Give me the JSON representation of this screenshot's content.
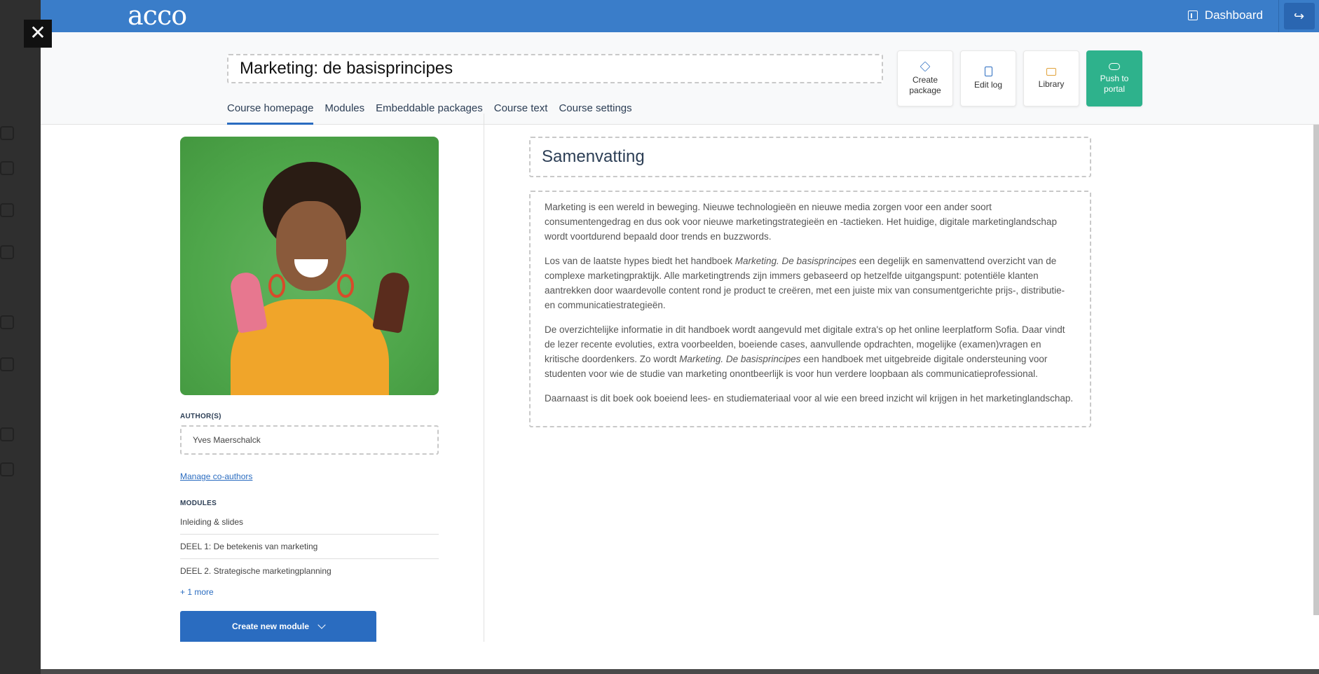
{
  "app": {
    "logo": "acco"
  },
  "topbar": {
    "dashboard_label": "Dashboard"
  },
  "course": {
    "title": "Marketing: de basisprincipes",
    "tabs": [
      {
        "label": "Course homepage",
        "active": true
      },
      {
        "label": "Modules"
      },
      {
        "label": "Embeddable packages"
      },
      {
        "label": "Course text"
      },
      {
        "label": "Course settings"
      }
    ],
    "actions": [
      {
        "label": "Create package",
        "icon": "cube-icon"
      },
      {
        "label": "Edit log",
        "icon": "clipboard-icon"
      },
      {
        "label": "Library",
        "icon": "folder-icon"
      },
      {
        "label": "Push to portal",
        "icon": "cloud-icon"
      }
    ]
  },
  "sidebar_panel": {
    "authors_label": "AUTHOR(S)",
    "author_value": "Yves Maerschalck",
    "manage_coauthors": "Manage co-authors",
    "modules_label": "MODULES",
    "modules": [
      "Inleiding & slides",
      "DEEL 1: De betekenis van marketing",
      "DEEL 2. Strategische marketingplanning"
    ],
    "more_link": "+ 1 more",
    "create_module": "Create new module"
  },
  "summary": {
    "title": "Samenvatting",
    "p1": "Marketing is een wereld in beweging. Nieuwe technologieën en nieuwe media zorgen voor een ander soort consumentengedrag en dus ook voor nieuwe marketingstrategieën en -tactieken. Het huidige, digitale marketinglandschap wordt voortdurend bepaald door trends en buzzwords.",
    "p2_a": "Los van de laatste hypes biedt het handboek ",
    "p2_em": "Marketing. De basisprincipes",
    "p2_b": " een degelijk en samenvattend overzicht van de complexe marketingpraktijk. Alle marketingtrends zijn immers gebaseerd op hetzelfde uitgangspunt: potentiële klanten aantrekken door waardevolle content rond je product te creëren, met een juiste mix van consumentgerichte prijs-, distributie- en communicatiestrategieën.",
    "p3_a": "De overzichtelijke informatie in dit handboek wordt aangevuld met digitale extra's op het online leerplatform Sofia. Daar vindt de lezer recente evoluties, extra voorbeelden, boeiende cases, aanvullende opdrachten, mogelijke (examen)vragen en kritische doordenkers. Zo wordt ",
    "p3_em": "Marketing. De basisprincipes",
    "p3_b": " een handboek met uitgebreide digitale ondersteuning voor studenten voor wie de studie van marketing onontbeerlijk is voor hun verdere loopbaan als communicatieprofessional.",
    "p4": "Daarnaast is dit boek ook boeiend lees- en studiemateriaal voor al wie een breed inzicht wil krijgen in het marketinglandschap."
  },
  "colors": {
    "brand_blue": "#3a7dc9",
    "primary_button": "#2a6cc0",
    "push_green": "#2eb28c"
  }
}
